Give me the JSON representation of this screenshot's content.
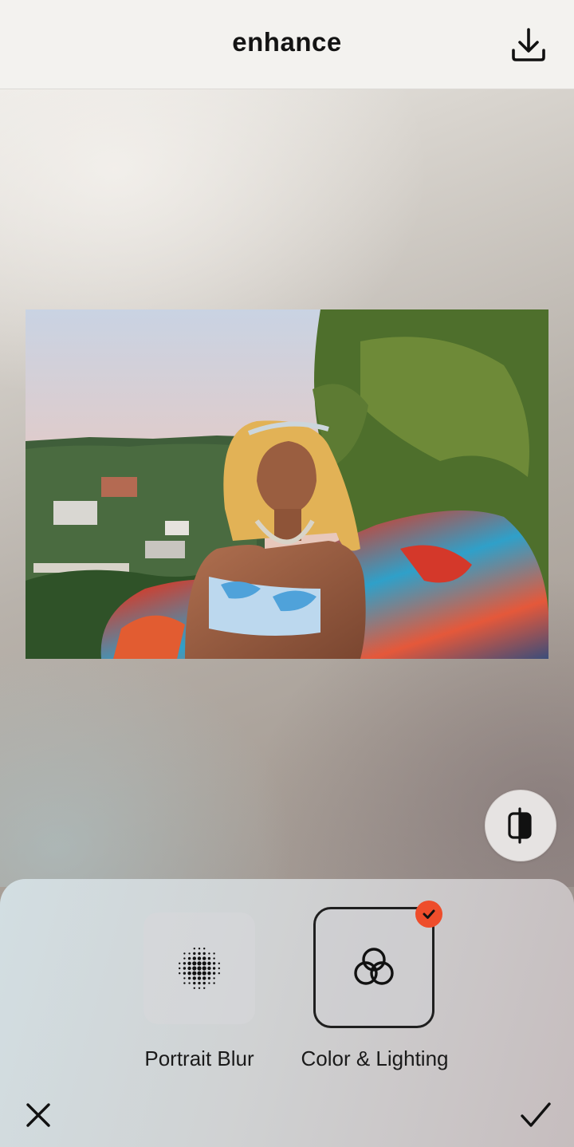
{
  "header": {
    "title": "enhance",
    "download_icon": "download-icon"
  },
  "photo": {
    "description_icon": "photo-preview"
  },
  "compare": {
    "icon": "compare-split-icon"
  },
  "tools": {
    "items": [
      {
        "label": "Portrait Blur",
        "icon": "dots-blur-icon",
        "selected": false
      },
      {
        "label": "Color & Lighting",
        "icon": "interlocking-circles-icon",
        "selected": true
      }
    ]
  },
  "footer": {
    "cancel_icon": "close-icon",
    "apply_icon": "checkmark-icon"
  },
  "colors": {
    "accent": "#ee4d2b",
    "text": "#141414"
  }
}
